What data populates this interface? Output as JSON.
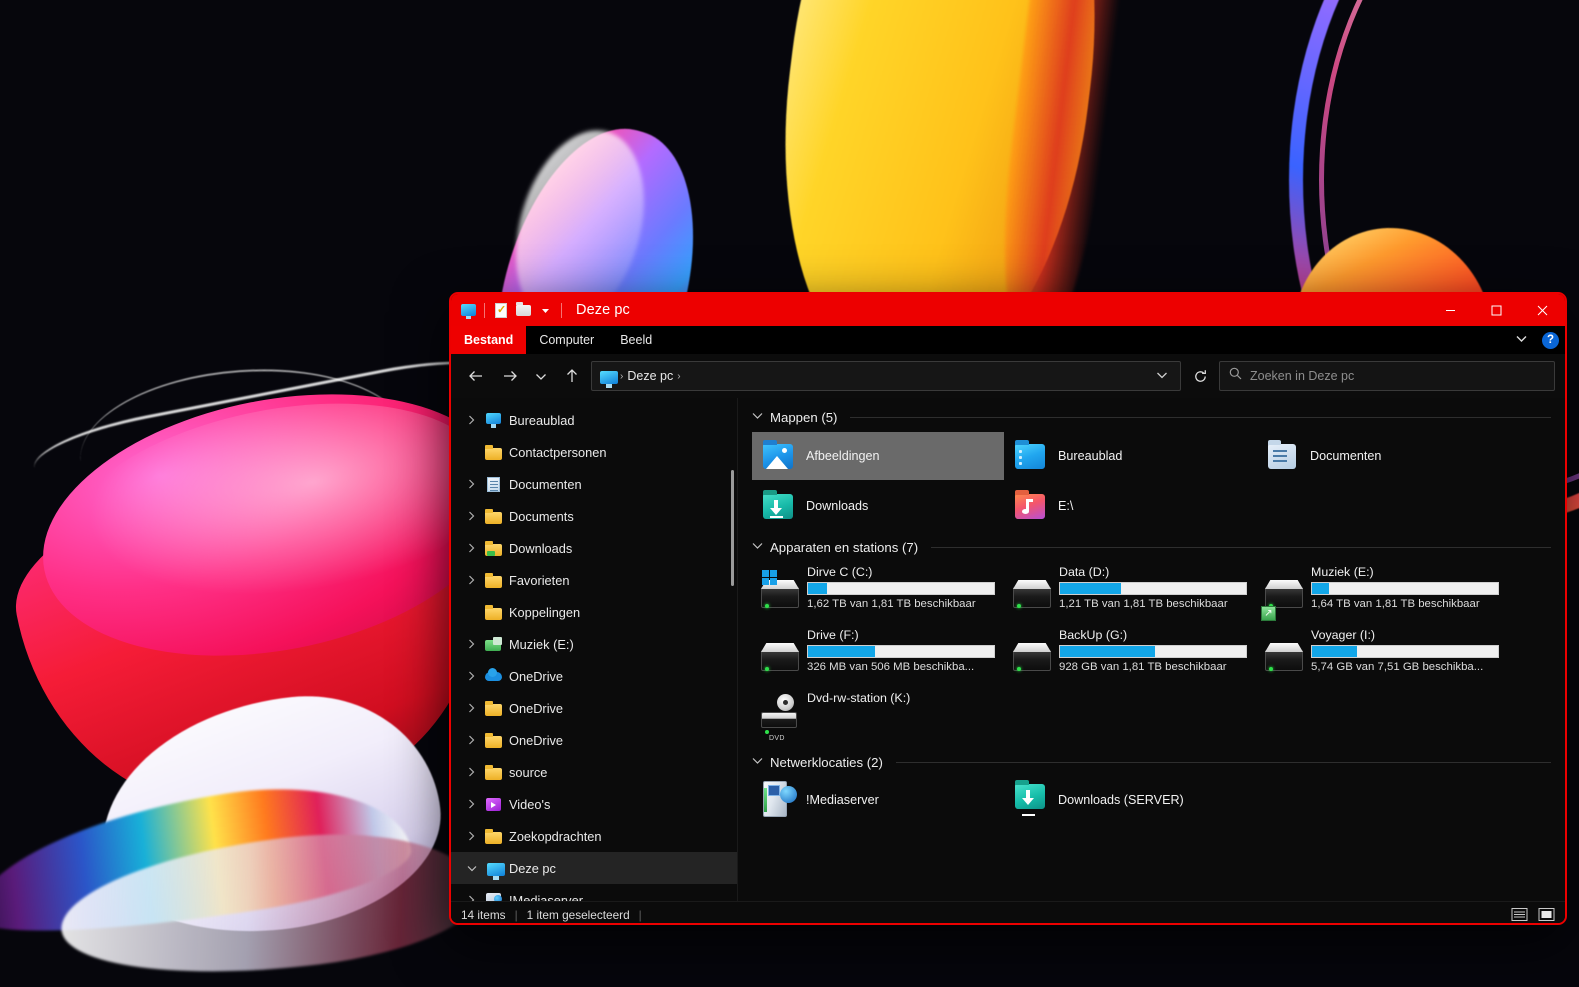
{
  "window": {
    "title": "Deze pc",
    "accent_color": "#ed0000",
    "quick_access": [
      "monitor-icon",
      "properties-icon",
      "new-folder-icon",
      "qat-dropdown-icon"
    ],
    "controls": {
      "minimize": "─",
      "maximize": "☐",
      "close": "✕"
    }
  },
  "ribbon": {
    "tabs": [
      {
        "label": "Bestand",
        "active": true
      },
      {
        "label": "Computer",
        "active": false
      },
      {
        "label": "Beeld",
        "active": false
      }
    ],
    "collapse_label": "⌄",
    "help_label": "?"
  },
  "toolbar": {
    "back": "←",
    "forward": "→",
    "recent": "⌄",
    "up": "↑",
    "refresh": "↻",
    "address_caret": "⌄"
  },
  "address": {
    "crumbs": [
      "Deze pc"
    ],
    "separator": "›",
    "leading_separator": "›"
  },
  "search": {
    "placeholder": "Zoeken in Deze pc",
    "value": "",
    "icon": "search-icon"
  },
  "navpane": {
    "items": [
      {
        "label": "Bureaublad",
        "icon": "monitor-icon",
        "chevron": true,
        "indent": 0,
        "selected": false
      },
      {
        "label": "Contactpersonen",
        "icon": "folder-icon",
        "chevron": false,
        "indent": 0,
        "selected": false
      },
      {
        "label": "Documenten",
        "icon": "document-icon",
        "chevron": true,
        "indent": 0,
        "selected": false
      },
      {
        "label": "Documents",
        "icon": "folder-icon",
        "chevron": true,
        "indent": 0,
        "selected": false
      },
      {
        "label": "Downloads",
        "icon": "folder-download-icon",
        "chevron": true,
        "indent": 0,
        "selected": false
      },
      {
        "label": "Favorieten",
        "icon": "folder-icon",
        "chevron": true,
        "indent": 0,
        "selected": false
      },
      {
        "label": "Koppelingen",
        "icon": "folder-icon",
        "chevron": false,
        "indent": 0,
        "selected": false
      },
      {
        "label": "Muziek (E:)",
        "icon": "music-drive-icon",
        "chevron": true,
        "indent": 0,
        "selected": false
      },
      {
        "label": "OneDrive",
        "icon": "cloud-icon",
        "chevron": true,
        "indent": 0,
        "selected": false
      },
      {
        "label": "OneDrive",
        "icon": "folder-icon",
        "chevron": true,
        "indent": 0,
        "selected": false
      },
      {
        "label": "OneDrive",
        "icon": "folder-icon",
        "chevron": true,
        "indent": 0,
        "selected": false
      },
      {
        "label": "source",
        "icon": "folder-icon",
        "chevron": true,
        "indent": 0,
        "selected": false
      },
      {
        "label": "Video's",
        "icon": "video-icon",
        "chevron": true,
        "indent": 0,
        "selected": false
      },
      {
        "label": "Zoekopdrachten",
        "icon": "folder-icon",
        "chevron": true,
        "indent": 0,
        "selected": false
      },
      {
        "label": "Deze pc",
        "icon": "this-pc-icon",
        "chevron": true,
        "indent": 0,
        "selected": true,
        "expanded": true
      },
      {
        "label": "!Mediaserver",
        "icon": "network-server-icon",
        "chevron": true,
        "indent": 0,
        "selected": false
      }
    ]
  },
  "groups": {
    "folders": {
      "title": "Mappen (5)",
      "chevron": "⌄",
      "items": [
        {
          "label": "Afbeeldingen",
          "icon": "folder-pictures-icon",
          "selected": true
        },
        {
          "label": "Bureaublad",
          "icon": "folder-desktop-icon",
          "selected": false
        },
        {
          "label": "Documenten",
          "icon": "folder-documents-icon",
          "selected": false
        },
        {
          "label": "Downloads",
          "icon": "folder-downloads-icon",
          "selected": false
        },
        {
          "label": "E:\\",
          "icon": "folder-music-icon",
          "selected": false
        }
      ]
    },
    "drives": {
      "title": "Apparaten en stations (7)",
      "chevron": "⌄",
      "items": [
        {
          "name": "Dirve C (C:)",
          "free_text": "1,62 TB van 1,81 TB beschikbaar",
          "used_percent": 10,
          "icon": "hdd-windows-icon",
          "has_bar": true,
          "shared": false
        },
        {
          "name": "Data (D:)",
          "free_text": "1,21 TB van 1,81 TB beschikbaar",
          "used_percent": 33,
          "icon": "hdd-icon",
          "has_bar": true,
          "shared": false
        },
        {
          "name": "Muziek (E:)",
          "free_text": "1,64 TB van 1,81 TB beschikbaar",
          "used_percent": 9,
          "icon": "hdd-shared-icon",
          "has_bar": true,
          "shared": true
        },
        {
          "name": "Drive (F:)",
          "free_text": "326 MB van 506 MB beschikba...",
          "used_percent": 36,
          "icon": "hdd-icon",
          "has_bar": true,
          "shared": false
        },
        {
          "name": "BackUp (G:)",
          "free_text": "928 GB van 1,81 TB beschikbaar",
          "used_percent": 51,
          "icon": "hdd-icon",
          "has_bar": true,
          "shared": false
        },
        {
          "name": "Voyager (I:)",
          "free_text": "5,74 GB van 7,51 GB beschikba...",
          "used_percent": 24,
          "icon": "hdd-icon",
          "has_bar": true,
          "shared": false
        },
        {
          "name": "Dvd-rw-station (K:)",
          "free_text": "",
          "used_percent": 0,
          "icon": "dvd-drive-icon",
          "has_bar": false,
          "shared": false
        }
      ]
    },
    "network": {
      "title": "Netwerklocaties (2)",
      "chevron": "⌄",
      "items": [
        {
          "label": "!Mediaserver",
          "icon": "network-drive-icon"
        },
        {
          "label": "Downloads (SERVER)",
          "icon": "folder-network-download-icon"
        }
      ]
    }
  },
  "statusbar": {
    "item_count": "14 items",
    "selection": "1 item geselecteerd",
    "separator": "|",
    "views": [
      {
        "name": "details-view-icon",
        "active": false
      },
      {
        "name": "large-icons-view-icon",
        "active": true
      }
    ]
  }
}
